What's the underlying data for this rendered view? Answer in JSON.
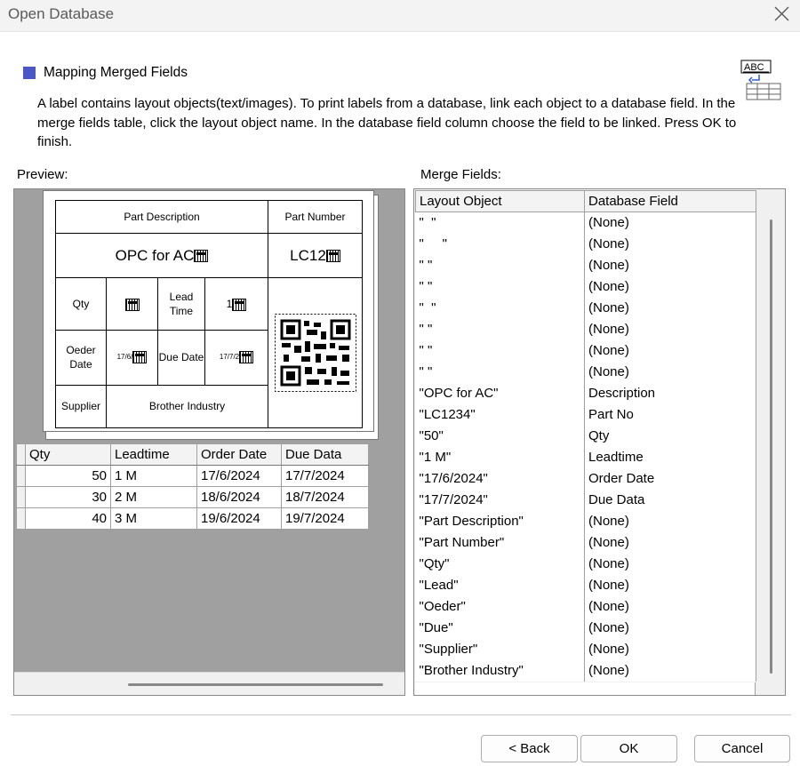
{
  "window": {
    "title": "Open Database"
  },
  "header": {
    "section_title": "Mapping Merged Fields",
    "description": "A label contains layout objects(text/images). To print labels from a database, link each object to a database field. In the merge fields table, click the layout object name. In the database field column choose the field to be linked.  Press OK to finish.",
    "icon": "abc-table-icon"
  },
  "preview": {
    "label": "Preview:",
    "label_layout": {
      "part_description": "Part Description",
      "part_number": "Part Number",
      "description_value": "OPC for AC",
      "part_number_value": "LC12",
      "qty": "Qty",
      "lead_time": "Lead Time",
      "lead_value": "1",
      "order_date": "Oeder Date",
      "order_value": "17/6/",
      "due_date": "Due Date",
      "due_value": "17/7/2",
      "supplier": "Supplier",
      "supplier_value": "Brother Industry"
    },
    "grid": {
      "columns": [
        "Qty",
        "Leadtime",
        "Order Date",
        "Due Data"
      ],
      "rows": [
        [
          "50",
          "1 M",
          "17/6/2024",
          "17/7/2024"
        ],
        [
          "30",
          "2 M",
          "18/6/2024",
          "18/7/2024"
        ],
        [
          "40",
          "3 M",
          "19/6/2024",
          "19/7/2024"
        ]
      ]
    }
  },
  "merge": {
    "label": "Merge Fields:",
    "columns": [
      "Layout Object",
      "Database Field"
    ],
    "rows": [
      [
        "\"  \"",
        "(None)"
      ],
      [
        "\"     \"",
        "(None)"
      ],
      [
        "\" \"",
        "(None)"
      ],
      [
        "\" \"",
        "(None)"
      ],
      [
        "\"  \"",
        "(None)"
      ],
      [
        "\" \"",
        "(None)"
      ],
      [
        "\" \"",
        "(None)"
      ],
      [
        "\" \"",
        "(None)"
      ],
      [
        "\"OPC for AC\"",
        "Description"
      ],
      [
        "\"LC1234\"",
        "Part No"
      ],
      [
        "\"50\"",
        "Qty"
      ],
      [
        "\"1 M\"",
        "Leadtime"
      ],
      [
        "\"17/6/2024\"",
        "Order Date"
      ],
      [
        "\"17/7/2024\"",
        "Due Data"
      ],
      [
        "\"Part Description\"",
        "(None)"
      ],
      [
        "\"Part Number\"",
        "(None)"
      ],
      [
        "\"Qty\"",
        "(None)"
      ],
      [
        "\"Lead\"",
        "(None)"
      ],
      [
        "\"Oeder\"",
        "(None)"
      ],
      [
        "\"Due\"",
        "(None)"
      ],
      [
        "\"Supplier\"",
        "(None)"
      ],
      [
        "\"Brother Industry\"",
        "(None)"
      ]
    ]
  },
  "buttons": {
    "back": "< Back",
    "ok": "OK",
    "cancel": "Cancel"
  },
  "colors": {
    "accent": "#4b57c6",
    "panel_gray": "#a0a0a0"
  }
}
